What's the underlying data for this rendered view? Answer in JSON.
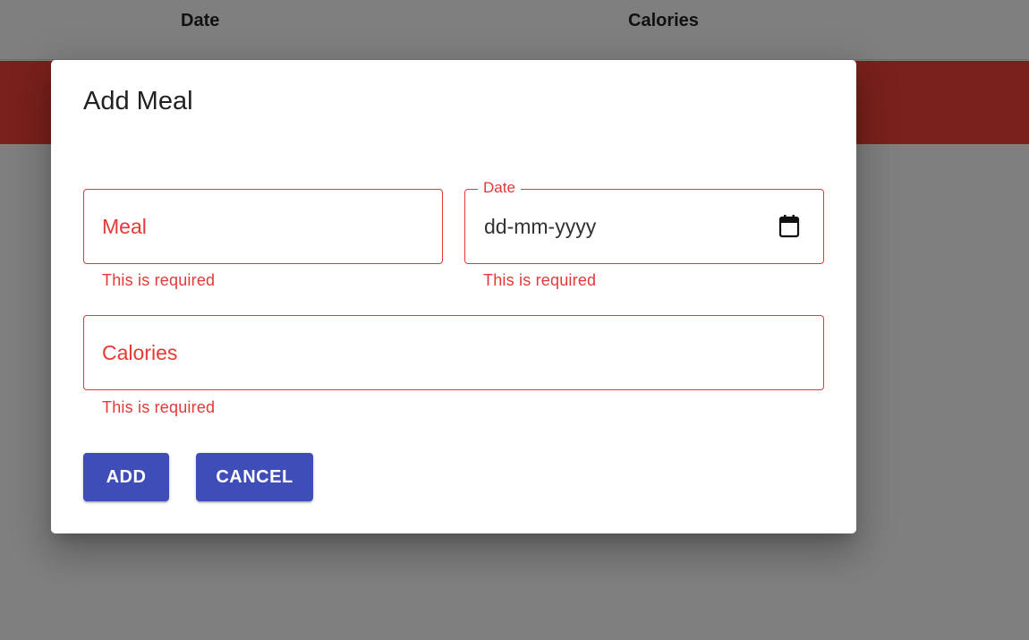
{
  "table": {
    "headers": [
      "Date",
      "Calories"
    ]
  },
  "dialog": {
    "title": "Add Meal",
    "fields": {
      "meal": {
        "placeholder": "Meal",
        "error": "This is required"
      },
      "date": {
        "label": "Date",
        "value": "dd-mm-yyyy",
        "error": "This is required",
        "icon": "calendar-icon"
      },
      "calories": {
        "placeholder": "Calories",
        "error": "This is required"
      }
    },
    "buttons": {
      "add": "ADD",
      "cancel": "CANCEL"
    }
  },
  "colors": {
    "error": "#e53935",
    "primary": "#3f4db8",
    "row_highlight": "#f44336"
  }
}
